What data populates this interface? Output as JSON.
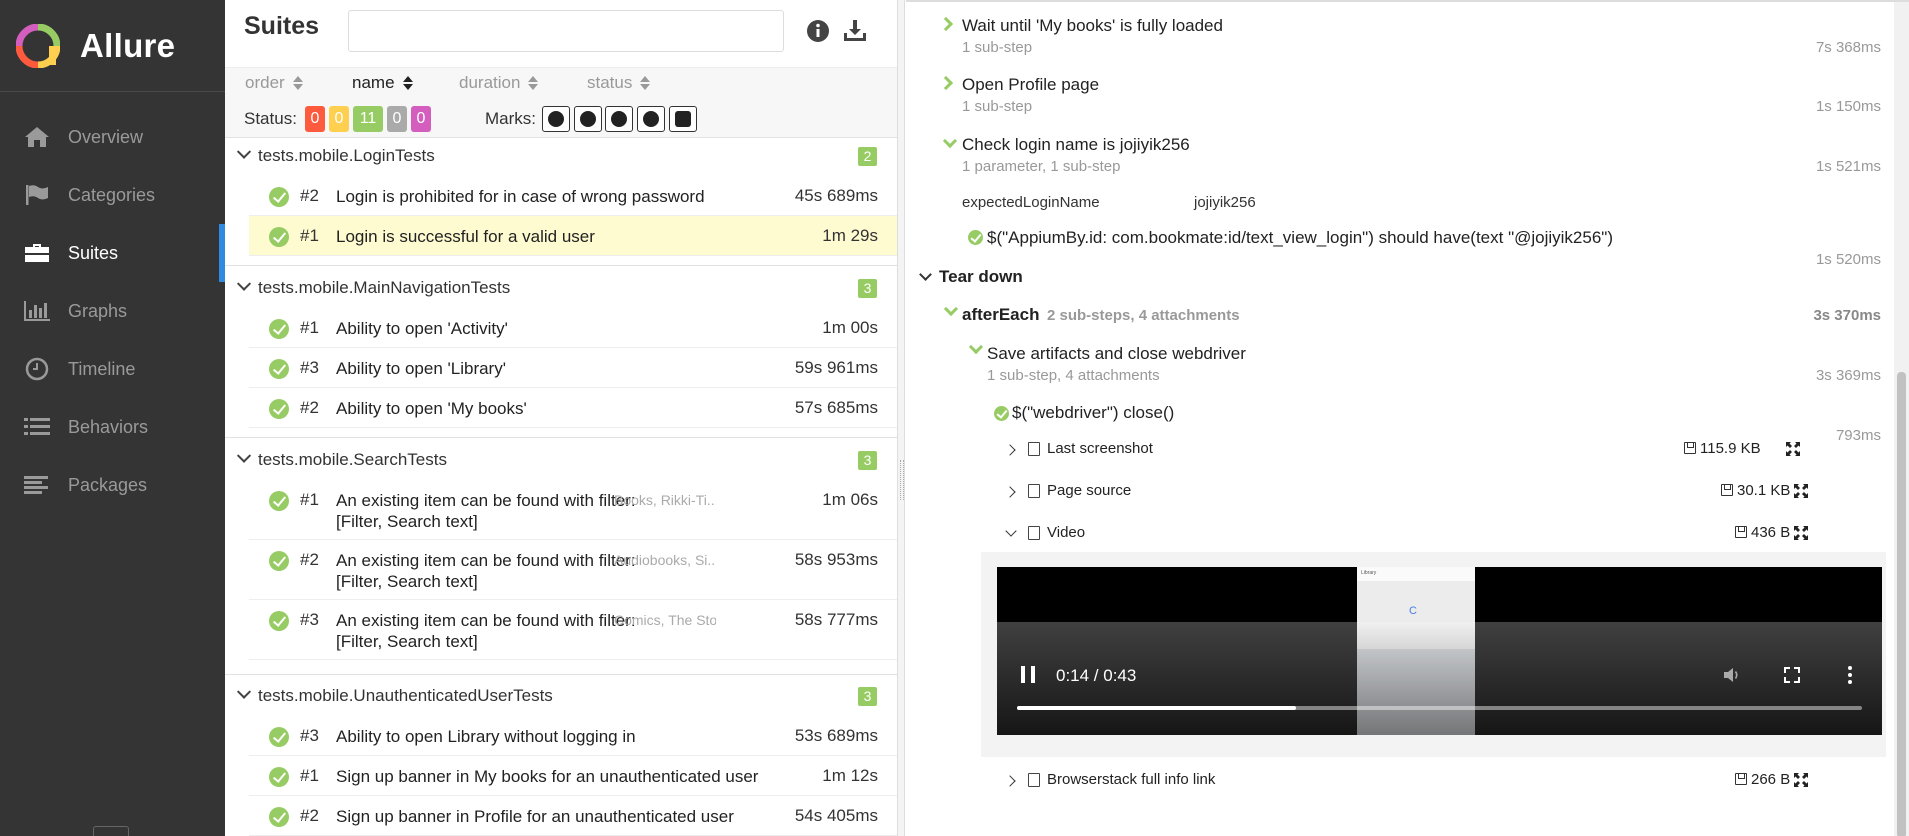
{
  "app": {
    "name": "Allure"
  },
  "nav": [
    {
      "label": "Overview",
      "icon": "home-icon"
    },
    {
      "label": "Categories",
      "icon": "flag-icon"
    },
    {
      "label": "Suites",
      "icon": "briefcase-icon",
      "active": true
    },
    {
      "label": "Graphs",
      "icon": "bar-chart-icon"
    },
    {
      "label": "Timeline",
      "icon": "clock-icon"
    },
    {
      "label": "Behaviors",
      "icon": "list-icon"
    },
    {
      "label": "Packages",
      "icon": "align-left-icon"
    }
  ],
  "suites": {
    "title": "Suites",
    "search_value": "",
    "sort": {
      "order": "order",
      "name": "name",
      "duration": "duration",
      "status": "status",
      "active": "name"
    },
    "status_label": "Status:",
    "status_counts": {
      "failed": "0",
      "broken": "0",
      "passed": "11",
      "skipped": "0",
      "unknown": "0"
    },
    "status_colors": {
      "failed": "#fd5a3e",
      "broken": "#ffd050",
      "passed": "#97cc64",
      "skipped": "#aaaaaa",
      "unknown": "#d35ebe"
    },
    "marks_label": "Marks:",
    "groups": [
      {
        "name": "tests.mobile.LoginTests",
        "count": "2",
        "tests": [
          {
            "num": "#2",
            "name": "Login is prohibited for in case of wrong password",
            "duration": "45s 689ms"
          },
          {
            "num": "#1",
            "name": "Login is successful for a valid user",
            "duration": "1m 29s",
            "selected": true
          }
        ]
      },
      {
        "name": "tests.mobile.MainNavigationTests",
        "count": "3",
        "tests": [
          {
            "num": "#1",
            "name": "Ability to open 'Activity'",
            "duration": "1m 00s"
          },
          {
            "num": "#3",
            "name": "Ability to open 'Library'",
            "duration": "59s 961ms"
          },
          {
            "num": "#2",
            "name": "Ability to open 'My books'",
            "duration": "57s 685ms"
          }
        ]
      },
      {
        "name": "tests.mobile.SearchTests",
        "count": "3",
        "tests": [
          {
            "num": "#1",
            "name_line1": "An existing item can be found with filter:",
            "name_line2": "[Filter, Search text]",
            "params": "Books, Rikki-Ti...",
            "duration": "1m 06s"
          },
          {
            "num": "#2",
            "name_line1": "An existing item can be found with filter:",
            "name_line2": "[Filter, Search text]",
            "params": "Audiobooks, Si...",
            "duration": "58s 953ms"
          },
          {
            "num": "#3",
            "name_line1": "An existing item can be found with filter:",
            "name_line2": "[Filter, Search text]",
            "params": "Comics, The Sto...",
            "duration": "58s 777ms"
          }
        ]
      },
      {
        "name": "tests.mobile.UnauthenticatedUserTests",
        "count": "3",
        "tests": [
          {
            "num": "#3",
            "name": "Ability to open Library without logging in",
            "duration": "53s 689ms"
          },
          {
            "num": "#1",
            "name": "Sign up banner in My books for an unauthenticated user",
            "duration": "1m 12s"
          },
          {
            "num": "#2",
            "name": "Sign up banner in Profile for an unauthenticated user",
            "duration": "54s 405ms"
          }
        ]
      }
    ]
  },
  "details": {
    "steps": [
      {
        "title": "Wait until 'My books' is fully loaded",
        "sub": "1 sub-step",
        "duration": "7s 368ms"
      },
      {
        "title": "Open Profile page",
        "sub": "1 sub-step",
        "duration": "1s 150ms"
      },
      {
        "title": "Check login name is jojiyik256",
        "sub": "1 parameter, 1 sub-step",
        "duration": "1s 521ms"
      }
    ],
    "param": {
      "name": "expectedLoginName",
      "value": "jojiyik256"
    },
    "substep": {
      "title": "$(\"AppiumBy.id: com.bookmate:id/text_view_login\") should have(text \"@jojiyik256\")",
      "duration": "1s 520ms"
    },
    "teardown_title": "Tear down",
    "after_each": {
      "title": "afterEach",
      "meta": "2 sub-steps, 4 attachments",
      "duration": "3s 370ms"
    },
    "save_artifacts": {
      "title": "Save artifacts and close webdriver",
      "sub": "1 sub-step, 4 attachments",
      "duration": "3s 369ms"
    },
    "close_step": {
      "title": "$(\"webdriver\") close()",
      "duration": "793ms"
    },
    "attachments": [
      {
        "name": "Last screenshot",
        "size": "115.9 KB",
        "icon": "image-icon"
      },
      {
        "name": "Page source",
        "size": "30.1 KB",
        "icon": "file-icon"
      },
      {
        "name": "Video",
        "size": "436 B",
        "icon": "video-file-icon",
        "expanded": true
      },
      {
        "name": "Browserstack full info link",
        "size": "266 B",
        "icon": "video-file-icon"
      }
    ],
    "video": {
      "time": "0:14 / 0:43",
      "progress": 0.33,
      "phone_title": "Library",
      "phone_char": "C"
    }
  }
}
